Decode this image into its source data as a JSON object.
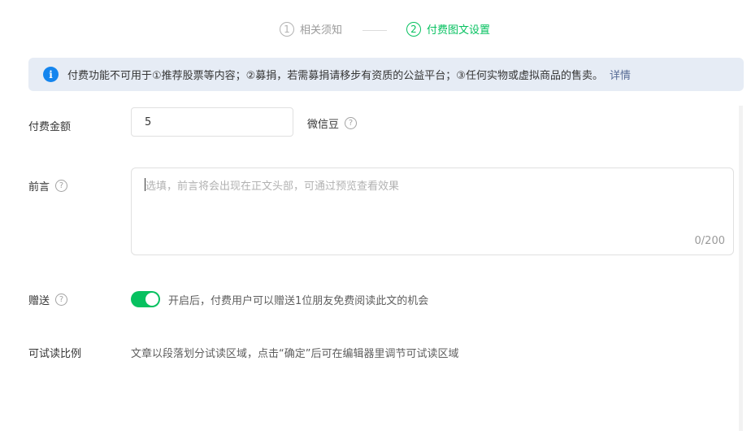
{
  "steps": [
    {
      "num": "1",
      "label": "相关须知"
    },
    {
      "num": "2",
      "label": "付费图文设置"
    }
  ],
  "notice": {
    "icon": "info-icon",
    "text": "付费功能不可用于①推荐股票等内容；②募捐，若需募捐请移步有资质的公益平台；③任何实物或虚拟商品的售卖。",
    "link": "详情"
  },
  "form": {
    "amount": {
      "label": "付费金额",
      "value": "5",
      "unit": "微信豆"
    },
    "preface": {
      "label": "前言",
      "placeholder": "选填，前言将会出现在正文头部，可通过预览查看效果",
      "counter": "0/200"
    },
    "gift": {
      "label": "赠送",
      "enabled": true,
      "desc": "开启后，付费用户可以赠送1位朋友免费阅读此文的机会"
    },
    "trial": {
      "label": "可试读比例",
      "desc": "文章以段落划分试读区域，点击“确定”后可在编辑器里调节可试读区域"
    }
  },
  "colors": {
    "accent": "#07c160",
    "info": "#1485ee",
    "link": "#576b95",
    "notice_bg": "#e6ecf5"
  },
  "help_icon_glyph": "?",
  "info_icon_glyph": "i"
}
